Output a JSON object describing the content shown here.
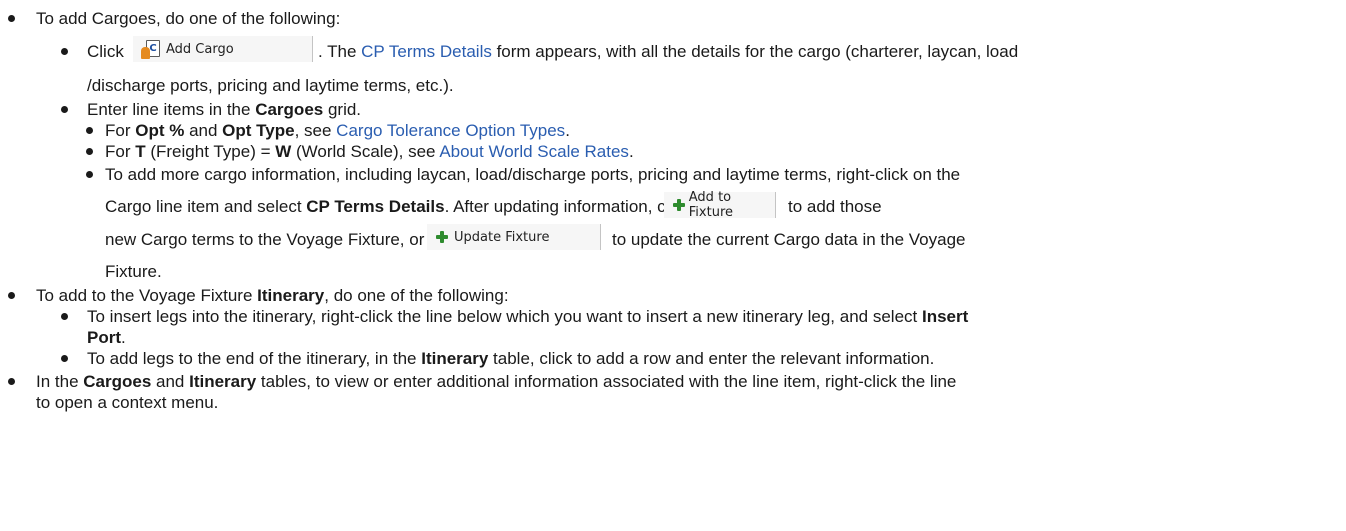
{
  "items": {
    "b1": {
      "text": "To add Cargoes, do one of the following:"
    },
    "b1_1": {
      "prefix": "Click",
      "button_label": "Add Cargo",
      "mid1": ". The ",
      "link": "CP Terms Details",
      "mid2": " form appears, with all the details for the cargo (charterer, laycan, load",
      "cont": "/discharge ports, pricing and laytime terms, etc.)."
    },
    "b1_2": {
      "prefix": "Enter line items in the ",
      "bold": "Cargoes",
      "suffix": " grid."
    },
    "b1_2_1": {
      "prefix": "For ",
      "bold1": "Opt %",
      "mid": " and ",
      "bold2": "Opt Type",
      "mid2": ", see ",
      "link": "Cargo Tolerance Option Types",
      "suffix": "."
    },
    "b1_2_2": {
      "prefix": "For ",
      "bold1": "T",
      "mid": " (Freight Type) = ",
      "bold2": "W",
      "mid2": " (World Scale), see ",
      "link": "About World Scale Rates",
      "suffix": "."
    },
    "b1_2_3": {
      "line1": "To add more cargo information, including laycan, load/discharge ports, pricing and laytime terms, right-click on the",
      "line2_prefix": "Cargo line item and select ",
      "line2_bold": "CP Terms Details",
      "line2_mid": ". After updating information, click",
      "add_btn": "Add to Fixture",
      "line2_suffix": "to add those",
      "line3_prefix": "new Cargo terms to the Voyage Fixture, or",
      "update_btn": "Update Fixture",
      "line3_suffix": "to update the current Cargo data in the Voyage",
      "line4": "Fixture."
    },
    "b2": {
      "prefix": "To add to the Voyage Fixture ",
      "bold": "Itinerary",
      "suffix": ", do one of the following:"
    },
    "b2_1": {
      "line1": "To insert legs into the itinerary, right-click the line below which you want to insert a new itinerary leg, and select ",
      "line1_bold": "Insert",
      "line2_bold": "Port",
      "line2_suffix": "."
    },
    "b2_2": {
      "prefix": "To add legs to the end of the itinerary, in the ",
      "bold": "Itinerary",
      "suffix": " table, click to add a row and enter the relevant information."
    },
    "b3": {
      "prefix": "In the ",
      "bold1": "Cargoes",
      "mid": " and ",
      "bold2": "Itinerary",
      "suffix": " tables, to view or enter additional information associated with the line item, right-click the line",
      "line2": "to open a context menu."
    }
  },
  "icons": {
    "bullet": "bullet-dot",
    "add_cargo": "add-cargo-icon",
    "plus": "green-plus-icon"
  },
  "colors": {
    "text": "#1a1a1a",
    "link": "#2a5db0",
    "plus_icon": "#2e8b2e",
    "button_bg": "#f6f6f6"
  }
}
